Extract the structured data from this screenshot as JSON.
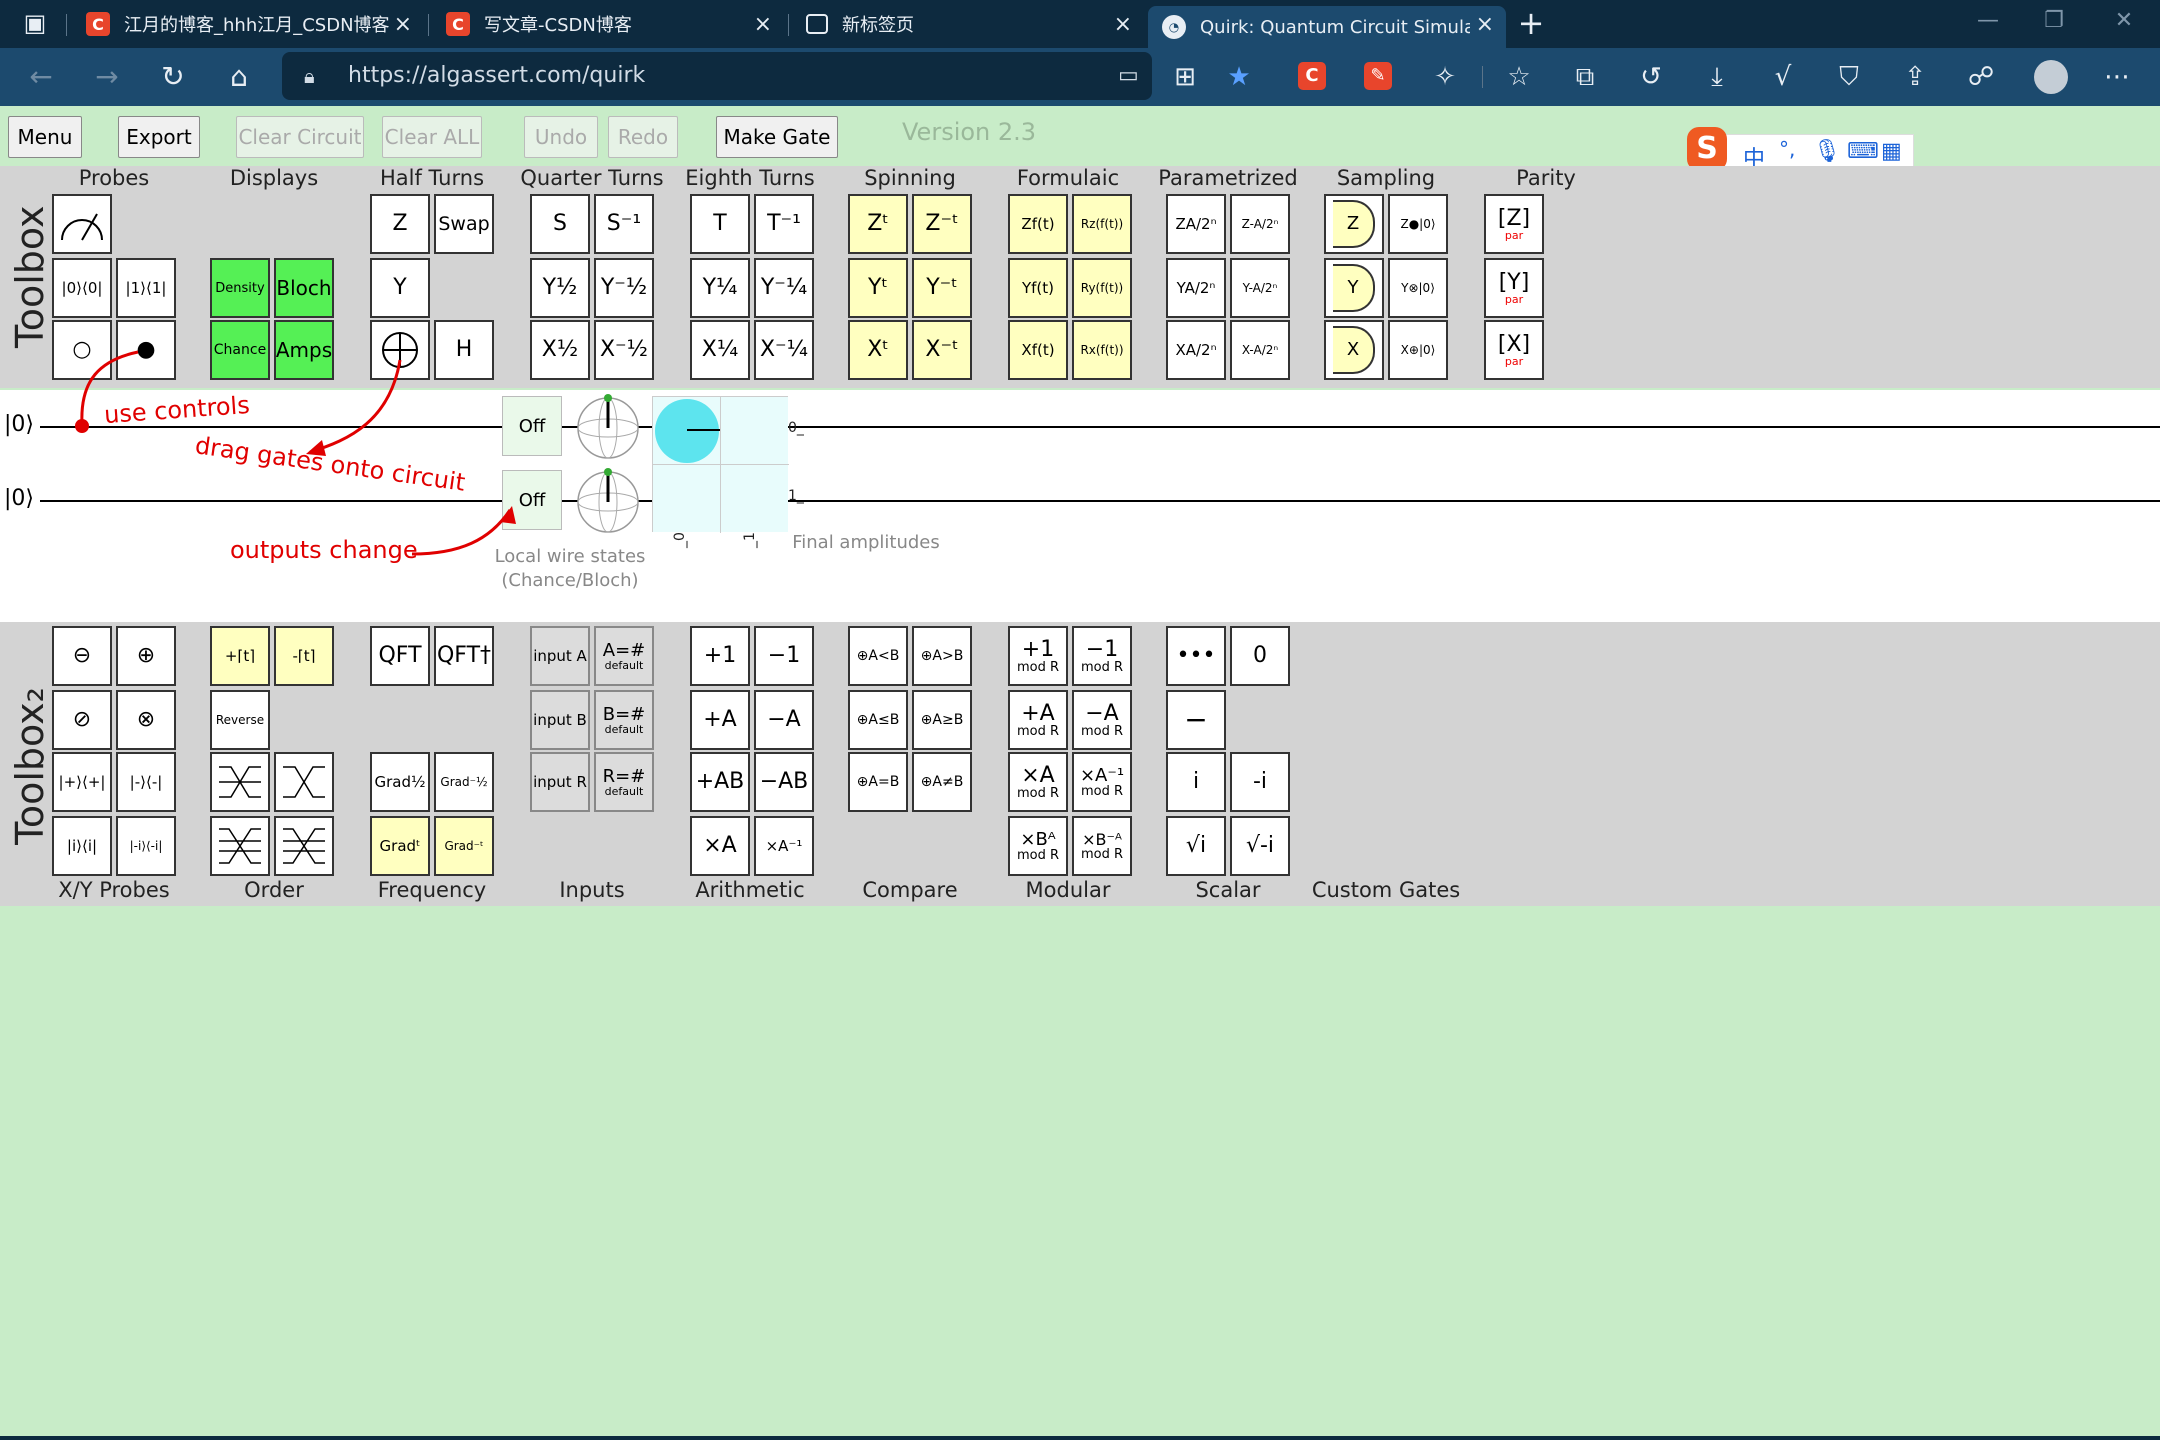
{
  "browser": {
    "tabs": [
      {
        "title": "江月的博客_hhh江月_CSDN博客",
        "favicon": "C"
      },
      {
        "title": "写文章-CSDN博客",
        "favicon": "C"
      },
      {
        "title": "新标签页",
        "favicon": ""
      },
      {
        "title": "Quirk: Quantum Circuit Simulator",
        "favicon": ""
      }
    ],
    "url": "https://algassert.com/quirk",
    "ext_csdn": "C"
  },
  "toolbar": {
    "menu": "Menu",
    "export": "Export",
    "clear_circuit": "Clear Circuit",
    "clear_all": "Clear ALL",
    "undo": "Undo",
    "redo": "Redo",
    "make_gate": "Make Gate",
    "version": "Version 2.3"
  },
  "ime": {
    "zh": "中",
    "punct": "°,"
  },
  "toolbox1": {
    "label": "Toolbox",
    "categories": {
      "probes": "Probes",
      "displays": "Displays",
      "half_turns": "Half Turns",
      "quarter_turns": "Quarter Turns",
      "eighth_turns": "Eighth Turns",
      "spinning": "Spinning",
      "formulaic": "Formulaic",
      "parametrized": "Parametrized",
      "sampling": "Sampling",
      "parity": "Parity"
    },
    "probes": {
      "p0": "|0⟩⟨0|",
      "p1": "|1⟩⟨1|",
      "anti": "○",
      "ctrl": "●"
    },
    "displays": {
      "density": "Density",
      "bloch": "Bloch",
      "chance": "Chance",
      "amps": "Amps"
    },
    "half": {
      "z": "Z",
      "swap": "Swap",
      "y": "Y",
      "h": "H"
    },
    "quarter": {
      "s": "S",
      "sinv": "S⁻¹",
      "y12": "Y½",
      "yn12": "Y⁻½",
      "x12": "X½",
      "xn12": "X⁻½"
    },
    "eighth": {
      "t": "T",
      "tinv": "T⁻¹",
      "y14": "Y¼",
      "yn14": "Y⁻¼",
      "x14": "X¼",
      "xn14": "X⁻¼"
    },
    "spinning": {
      "zt": "Zᵗ",
      "znt": "Z⁻ᵗ",
      "yt": "Yᵗ",
      "ynt": "Y⁻ᵗ",
      "xt": "Xᵗ",
      "xnt": "X⁻ᵗ"
    },
    "formulaic": {
      "zf": "Zf(t)",
      "rz": "Rz(f(t))",
      "yf": "Yf(t)",
      "ry": "Ry(f(t))",
      "xf": "Xf(t)",
      "rx": "Rx(f(t))"
    },
    "param": {
      "za": "ZA/2ⁿ",
      "zna": "Z-A/2ⁿ",
      "ya": "YA/2ⁿ",
      "yna": "Y-A/2ⁿ",
      "xa": "XA/2ⁿ",
      "xna": "X-A/2ⁿ"
    },
    "sampling": {
      "z": "Z",
      "z0": "Z●|0⟩",
      "y": "Y",
      "y0": "Y⊗|0⟩",
      "x": "X",
      "x0": "X⊕|0⟩"
    },
    "parity": {
      "z": "[Z]",
      "y": "[Y]",
      "x": "[X]",
      "sub": "par"
    }
  },
  "circuit": {
    "wire0": "|0⟩",
    "wire1": "|0⟩",
    "off0": "Off",
    "off1": "Off",
    "ann_controls": "use controls",
    "ann_drag": "drag gates onto circuit",
    "ann_outputs": "outputs change",
    "local_states_1": "Local wire states",
    "local_states_2": "(Chance/Bloch)",
    "final_amps": "Final amplitudes",
    "amp_row0": "0_",
    "amp_row1": "1_",
    "amp_col0": "_0",
    "amp_col1": "_1"
  },
  "toolbox2": {
    "label": "Toolbox₂",
    "categories": {
      "xy_probes": "X/Y Probes",
      "order": "Order",
      "frequency": "Frequency",
      "inputs": "Inputs",
      "arithmetic": "Arithmetic",
      "compare": "Compare",
      "modular": "Modular",
      "scalar": "Scalar",
      "custom": "Custom Gates"
    },
    "xy": {
      "m": "⊖",
      "p": "⊕",
      "o": "⊘",
      "x": "⊗",
      "plus": "|+⟩⟨+|",
      "minus": "|-⟩⟨-|",
      "i": "|i⟩⟨i|",
      "ni": "|-i⟩⟨-i|"
    },
    "order": {
      "plus_t": "+⌈t⌉",
      "minus_t": "-⌈t⌉",
      "reverse": "Reverse"
    },
    "freq": {
      "qft": "QFT",
      "qftd": "QFT†",
      "grad12": "Grad½",
      "gradn12": "Grad⁻½",
      "gradt": "Gradᵗ",
      "gradnt": "Grad⁻ᵗ"
    },
    "inputs": {
      "ia": "input A",
      "ib": "input B",
      "ir": "input R",
      "da": "A=#",
      "db": "B=#",
      "dr": "R=#",
      "def": "default"
    },
    "arith": {
      "p1": "+1",
      "m1": "−1",
      "pa": "+A",
      "ma": "−A",
      "pab": "+AB",
      "mab": "−AB",
      "xa": "×A",
      "xan": "×A⁻¹"
    },
    "compare": {
      "lt": "⊕A<B",
      "gt": "⊕A>B",
      "le": "⊕A≤B",
      "ge": "⊕A≥B",
      "eq": "⊕A=B",
      "ne": "⊕A≠B"
    },
    "modular": {
      "p1": "+1",
      "m1": "−1",
      "pa": "+A",
      "ma": "−A",
      "xa": "×A",
      "xan": "×A⁻¹",
      "xb": "×Bᴬ",
      "xbn": "×B⁻ᴬ",
      "mod": "mod R"
    },
    "scalar": {
      "dots": "•••",
      "zero": "0",
      "neg": "−",
      "i": "i",
      "ni": "-i",
      "si": "√i",
      "sni": "√-i"
    }
  },
  "colors": {
    "bg": "#c8ecc8",
    "band": "#d3d3d3",
    "yellow": "#ffffc0",
    "green": "#55f055",
    "cyan": "#5de4ee",
    "annotation": "#e00000"
  }
}
